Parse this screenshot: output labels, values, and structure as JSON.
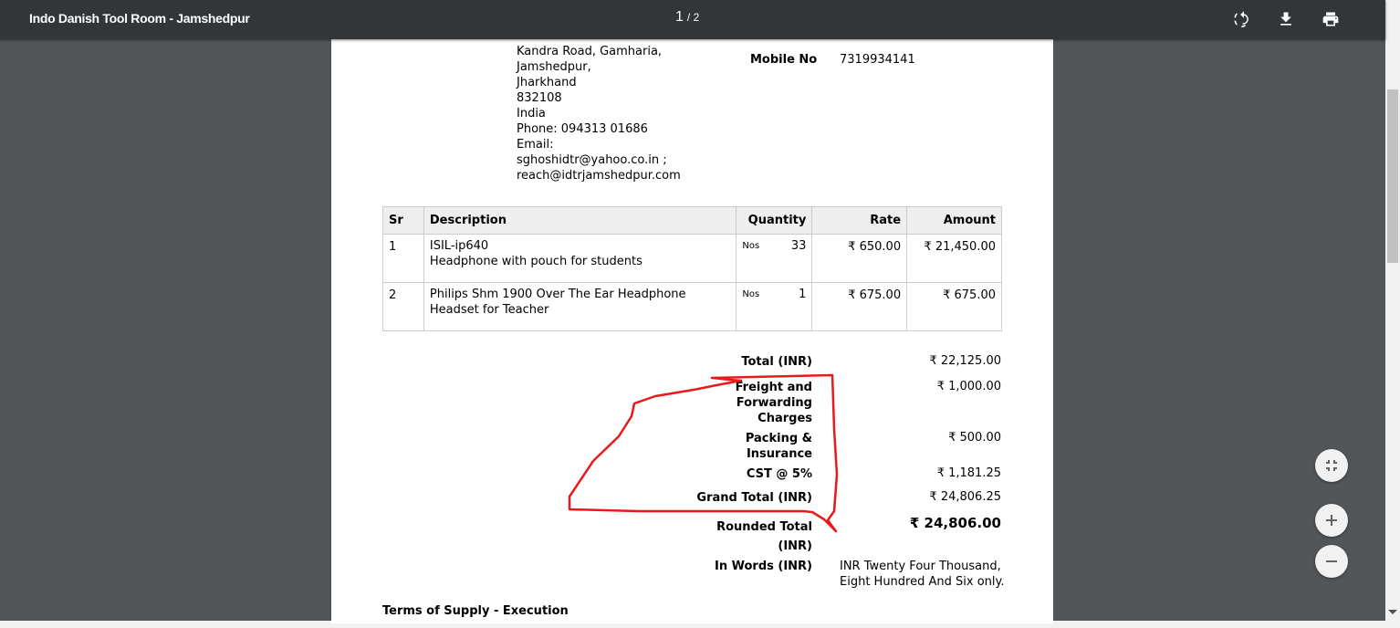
{
  "toolbar": {
    "title": "Indo Danish Tool Room - Jamshedpur",
    "page_current": "1",
    "page_total": "/ 2",
    "icons": [
      "rotate-icon",
      "download-icon",
      "print-icon"
    ]
  },
  "address": {
    "lines": [
      "Kandra Road, Gamharia,",
      "Jamshedpur,",
      "Jharkhand",
      "832108",
      "India",
      "Phone: 094313 01686",
      "Email:",
      "sghoshidtr@yahoo.co.in ;",
      "reach@idtrjamshedpur.com"
    ]
  },
  "contact": {
    "mobile_label": "Mobile No",
    "mobile_value": "7319934141"
  },
  "table": {
    "headers": {
      "sr": "Sr",
      "description": "Description",
      "quantity": "Quantity",
      "rate": "Rate",
      "amount": "Amount"
    },
    "rows": [
      {
        "sr": "1",
        "desc1": "ISIL-ip640",
        "desc2": "Headphone  with pouch for students",
        "unit": "Nos",
        "qty": "33",
        "rate": "₹ 650.00",
        "amount": "₹ 21,450.00"
      },
      {
        "sr": "2",
        "desc1": "Philips Shm 1900 Over The Ear Headphone",
        "desc2": "Headset for Teacher",
        "unit": "Nos",
        "qty": "1",
        "rate": "₹ 675.00",
        "amount": "₹ 675.00"
      }
    ]
  },
  "totals": {
    "total_label": "Total (INR)",
    "total_value": "₹ 22,125.00",
    "freight_label_1": "Freight and",
    "freight_label_2": "Forwarding",
    "freight_label_3": "Charges",
    "freight_value": "₹ 1,000.00",
    "packing_label_1": "Packing &",
    "packing_label_2": "Insurance",
    "packing_value": "₹ 500.00",
    "cst_label": "CST @ 5%",
    "cst_value": "₹ 1,181.25",
    "grand_label": "Grand Total (INR)",
    "grand_value": "₹ 24,806.25",
    "rounded_label_1": "Rounded Total",
    "rounded_label_2": "(INR)",
    "rounded_value": "₹ 24,806.00",
    "words_label": "In Words (INR)",
    "words_line1": "INR Twenty Four Thousand,",
    "words_line2": "Eight Hundred And Six only."
  },
  "terms": {
    "heading": "Terms of Supply - Execution"
  },
  "annotation": {
    "color": "#e8191a"
  },
  "controls": {
    "icons": [
      "fit-page-icon",
      "zoom-in-icon",
      "zoom-out-icon"
    ]
  }
}
